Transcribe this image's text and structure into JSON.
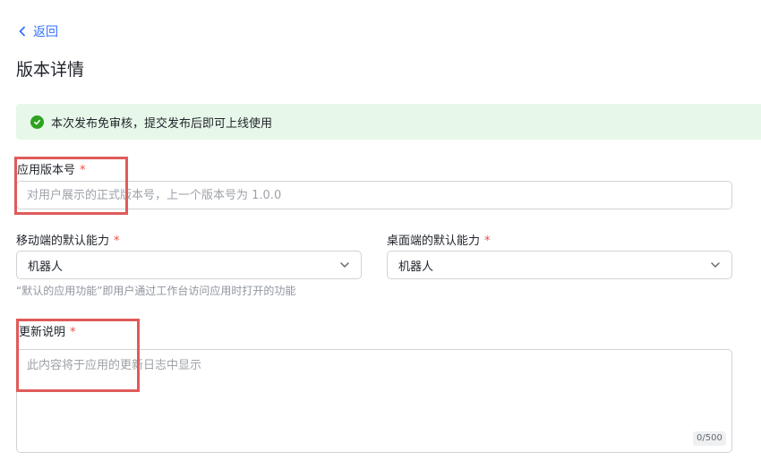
{
  "nav": {
    "back_label": "返回"
  },
  "page": {
    "title": "版本详情"
  },
  "notice": {
    "text": "本次发布免审核，提交发布后即可上线使用",
    "color": "#2ea121"
  },
  "form": {
    "required_mark": "*",
    "version": {
      "label": "应用版本号",
      "value": "",
      "placeholder": "对用户展示的正式版本号，上一个版本号为 1.0.0"
    },
    "mobile_default": {
      "label": "移动端的默认能力",
      "selected": "机器人"
    },
    "desktop_default": {
      "label": "桌面端的默认能力",
      "selected": "机器人"
    },
    "default_hint": "“默认的应用功能”即用户通过工作台访问应用时打开的功能",
    "release_notes": {
      "label": "更新说明",
      "value": "",
      "placeholder": "此内容将于应用的更新日志中显示",
      "counter": "0/500"
    }
  },
  "colors": {
    "accent": "#3370ff",
    "required": "#f54a45",
    "annotation": "#e05a5a"
  }
}
